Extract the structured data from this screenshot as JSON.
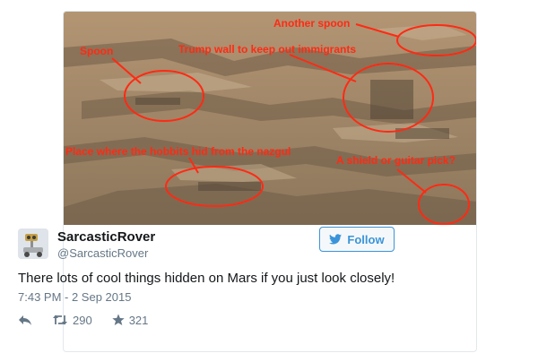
{
  "photo": {
    "annotations": [
      {
        "label": "Another spoon"
      },
      {
        "label": "Spoon"
      },
      {
        "label": "Trump wall to keep out immigrants"
      },
      {
        "label": "Place where the hobbits hid from the nazgul"
      },
      {
        "label": "A shield or guitar pick?"
      }
    ],
    "colors": {
      "annotation": "#ff2a14",
      "rock": "#9b8466",
      "sky": "#b89a78"
    }
  },
  "tweet": {
    "author_name": "SarcasticRover",
    "author_handle": "@SarcasticRover",
    "follow_label": "Follow",
    "text": "There lots of cool things hidden on Mars if you just look closely!",
    "timestamp": "7:43 PM - 2 Sep 2015",
    "retweet_count": "290",
    "like_count": "321"
  },
  "icons": {
    "follow": "twitter-bird-icon",
    "reply": "reply-icon",
    "retweet": "retweet-icon",
    "like": "star-icon"
  }
}
